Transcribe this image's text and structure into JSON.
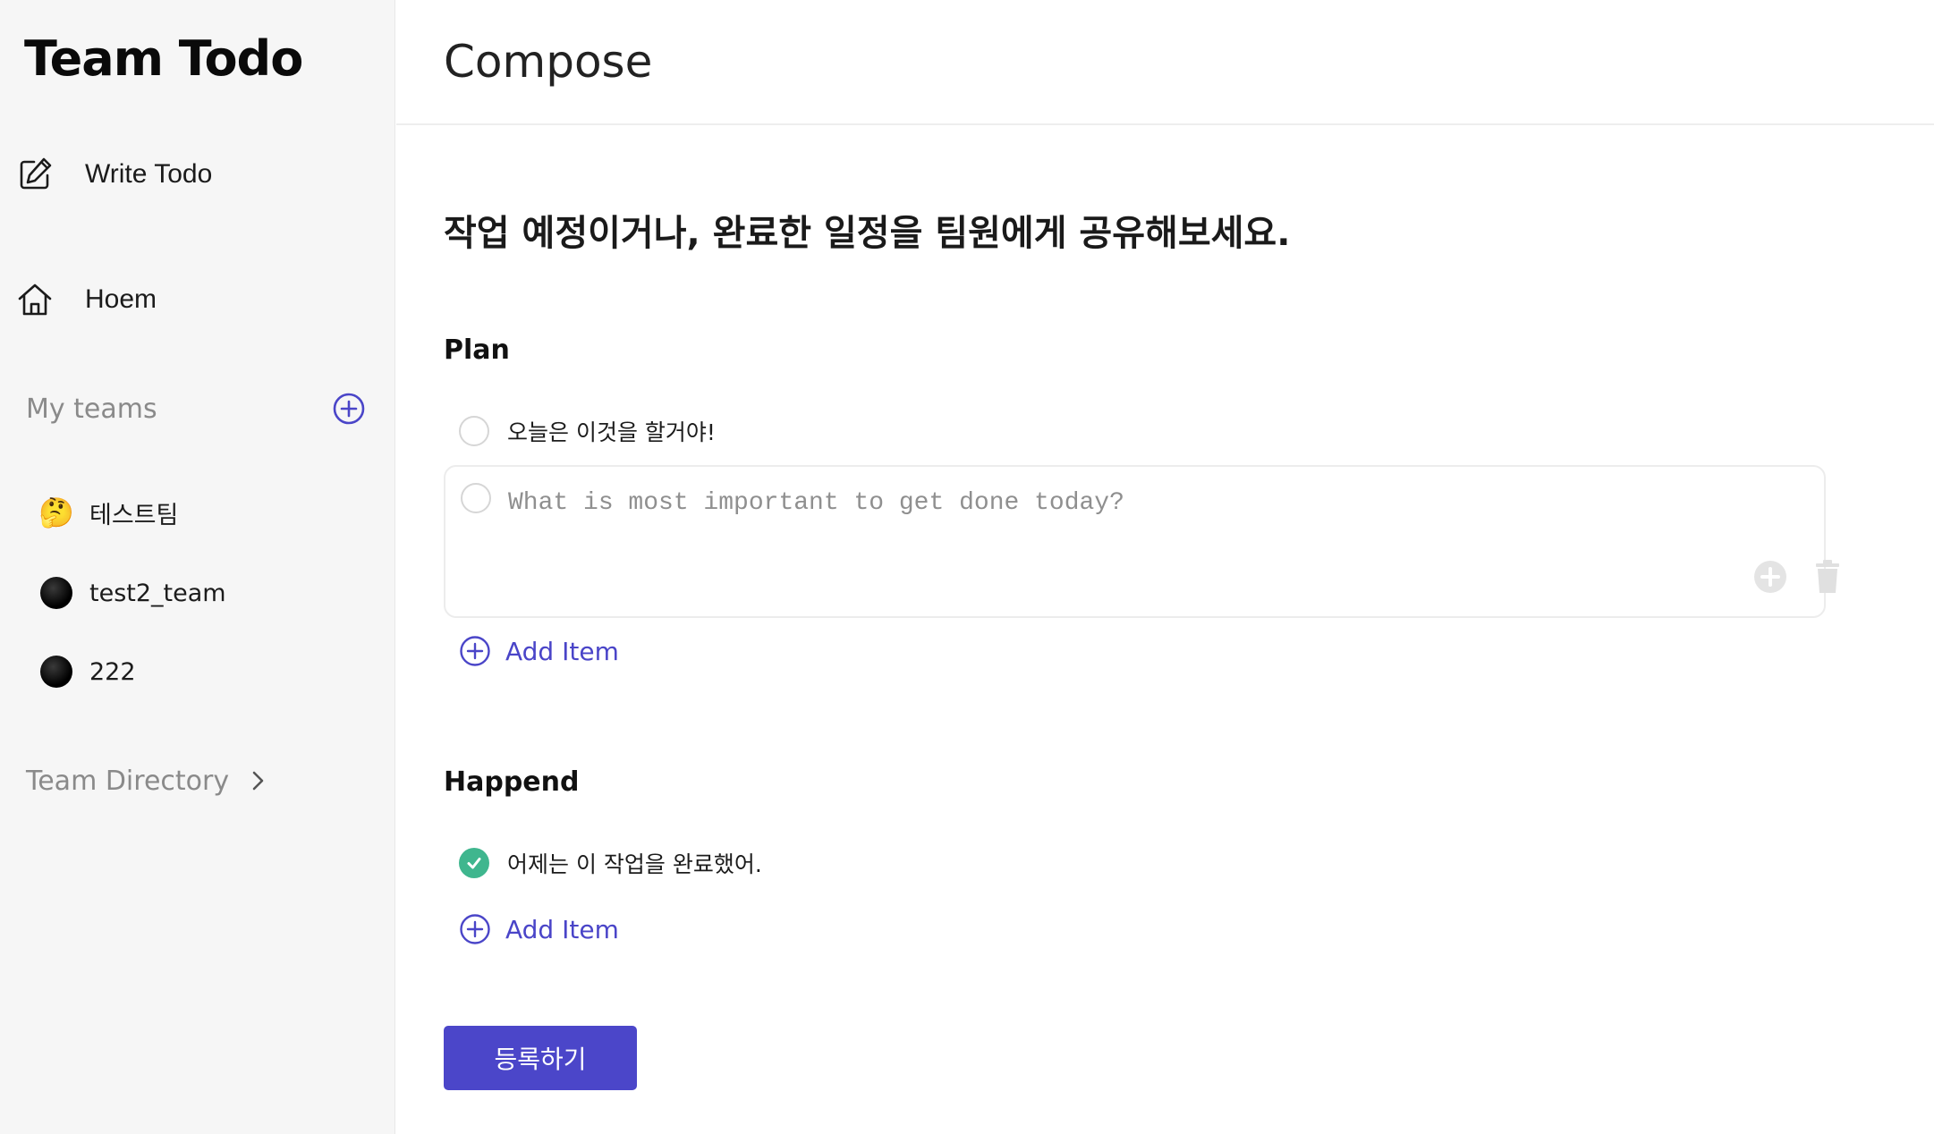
{
  "app": {
    "logo": "Team Todo"
  },
  "sidebar": {
    "nav": [
      {
        "label": "Write Todo",
        "icon": "edit-icon"
      },
      {
        "label": "Hoem",
        "icon": "home-icon"
      }
    ],
    "my_teams_label": "My teams",
    "teams": [
      {
        "name": "테스트팀",
        "icon": "🤔"
      },
      {
        "name": "test2_team",
        "icon": "black-circle"
      },
      {
        "name": "222",
        "icon": "black-circle"
      }
    ],
    "team_directory_label": "Team Directory"
  },
  "header": {
    "title": "Compose"
  },
  "main": {
    "subtitle": "작업 예정이거나, 완료한 일정을 팀원에게 공유해보세요.",
    "plan": {
      "title": "Plan",
      "items": [
        {
          "text": "오늘은 이것을 할거야!",
          "done": false
        }
      ],
      "editor_placeholder": "What is most important to get done today?",
      "add_item_label": "Add Item"
    },
    "happend": {
      "title": "Happend",
      "items": [
        {
          "text": "어제는 이 작업을 완료했어.",
          "done": true
        }
      ],
      "add_item_label": "Add Item"
    },
    "submit_label": "등록하기"
  },
  "colors": {
    "accent": "#4b46c9",
    "done_check": "#3fb68e",
    "sidebar_bg": "#f6f6f6",
    "muted_text": "#8a8a8a"
  }
}
